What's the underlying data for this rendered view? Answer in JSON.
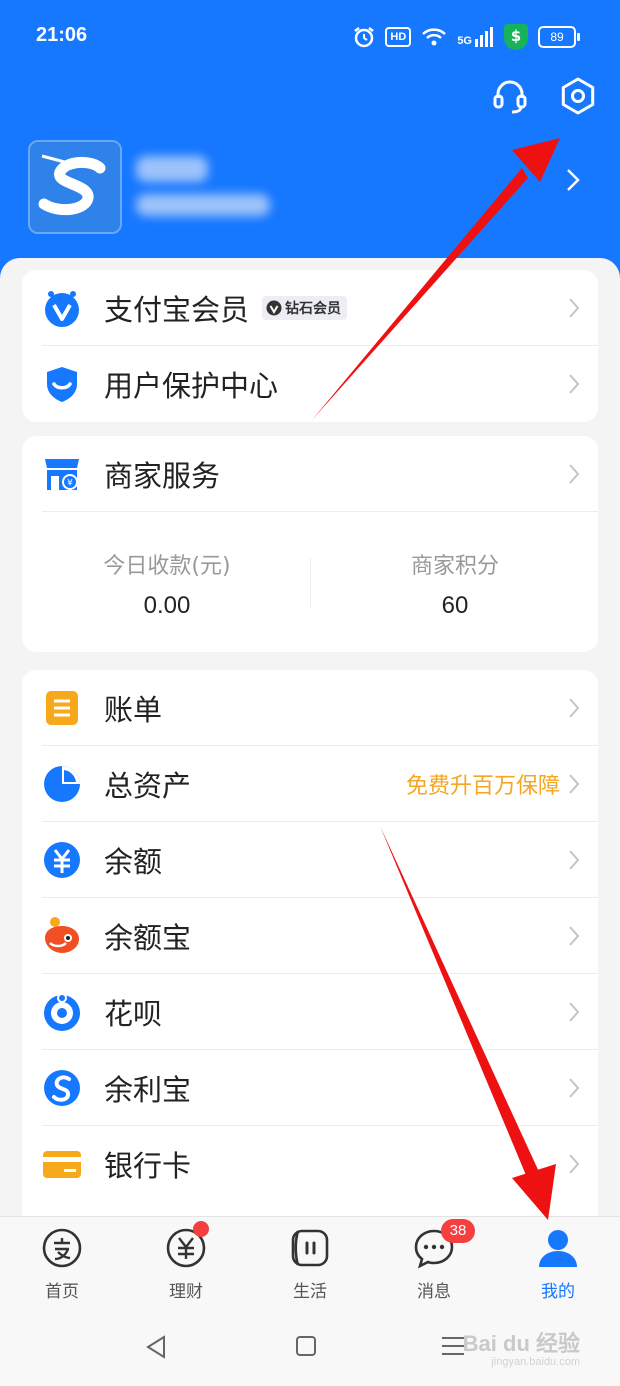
{
  "status_bar": {
    "time": "21:06",
    "hd": "HD",
    "network": "5G",
    "battery": "89"
  },
  "header": {
    "profile_name": "",
    "profile_account": ""
  },
  "membership_card": {
    "items": [
      {
        "label": "支付宝会员",
        "badge": "钻石会员"
      },
      {
        "label": "用户保护中心"
      }
    ]
  },
  "merchant_card": {
    "title": "商家服务",
    "stats": [
      {
        "label": "今日收款(元)",
        "value": "0.00"
      },
      {
        "label": "商家积分",
        "value": "60"
      }
    ]
  },
  "finance_list": {
    "items": [
      {
        "label": "账单",
        "icon": "bill-icon"
      },
      {
        "label": "总资产",
        "icon": "total-assets-icon",
        "promo": "免费升百万保障"
      },
      {
        "label": "余额",
        "icon": "balance-yuan-icon"
      },
      {
        "label": "余额宝",
        "icon": "yuebao-icon"
      },
      {
        "label": "花呗",
        "icon": "huabei-icon"
      },
      {
        "label": "余利宝",
        "icon": "yulibao-icon"
      },
      {
        "label": "银行卡",
        "icon": "bank-card-icon"
      }
    ]
  },
  "tab_bar": {
    "tabs": [
      {
        "label": "首页",
        "icon": "alipay-home-icon"
      },
      {
        "label": "理财",
        "icon": "wealth-icon",
        "has_dot": true
      },
      {
        "label": "生活",
        "icon": "life-icon"
      },
      {
        "label": "消息",
        "icon": "message-icon",
        "count": "38"
      },
      {
        "label": "我的",
        "icon": "profile-icon",
        "active": true
      }
    ]
  },
  "watermark": {
    "brand": "Bai du 经验",
    "url": "jingyan.baidu.com"
  },
  "colors": {
    "primary": "#1677ff",
    "promo": "#f5a623",
    "badge_red": "#f53f3f",
    "annotation_arrow": "#ee1111"
  }
}
